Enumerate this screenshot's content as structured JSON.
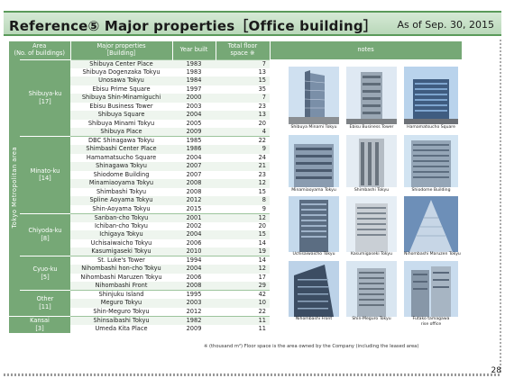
{
  "header": {
    "title": "Reference⑤ Major properties［Office building］",
    "as_of": "As of Sep. 30, 2015"
  },
  "table": {
    "headers": {
      "area": "Area",
      "area_sub": "(No. of buildings)",
      "property": "Major properties",
      "property_sub": "［Building］",
      "year": "Year built",
      "floor": "Total floor",
      "floor_sub": "space ※",
      "notes": "notes"
    },
    "metro_label": "Tokyo Metropolitan area",
    "groups": [
      {
        "area": "Shibuya-ku",
        "count": "[17]",
        "rows": [
          {
            "name": "Shibuya Center Place",
            "year": "1983",
            "floor": "7"
          },
          {
            "name": "Shibuya Dogenzaka Tokyu",
            "year": "1983",
            "floor": "13"
          },
          {
            "name": "Unosawa Tokyu",
            "year": "1984",
            "floor": "15"
          },
          {
            "name": "Ebisu Prime Square",
            "year": "1997",
            "floor": "35"
          },
          {
            "name": "Shibuya Shin-Minamiguchi",
            "year": "2000",
            "floor": "7"
          },
          {
            "name": "Ebisu Business Tower",
            "year": "2003",
            "floor": "23"
          },
          {
            "name": "Shibuya Square",
            "year": "2004",
            "floor": "13"
          },
          {
            "name": "Shibuya Minami Tokyu",
            "year": "2005",
            "floor": "20"
          },
          {
            "name": "Shibuya Place",
            "year": "2009",
            "floor": "4"
          }
        ]
      },
      {
        "area": "Minato-ku",
        "count": "[14]",
        "rows": [
          {
            "name": "DBC Shinagawa Tokyu",
            "year": "1985",
            "floor": "22"
          },
          {
            "name": "Shimbashi Center Place",
            "year": "1986",
            "floor": "9"
          },
          {
            "name": "Hamamatsucho Square",
            "year": "2004",
            "floor": "24"
          },
          {
            "name": "Shinagawa Tokyu",
            "year": "2007",
            "floor": "21"
          },
          {
            "name": "Shiodome Building",
            "year": "2007",
            "floor": "23"
          },
          {
            "name": "Minamiaoyama Tokyu",
            "year": "2008",
            "floor": "12"
          },
          {
            "name": "Shimbashi Tokyu",
            "year": "2008",
            "floor": "15"
          },
          {
            "name": "Spline Aoyama Tokyu",
            "year": "2012",
            "floor": "8"
          },
          {
            "name": "Shin-Aoyama Tokyu",
            "year": "2015",
            "floor": "9"
          }
        ]
      },
      {
        "area": "Chiyoda-ku",
        "count": "[8]",
        "rows": [
          {
            "name": "Sanban-cho Tokyu",
            "year": "2001",
            "floor": "12"
          },
          {
            "name": "Ichiban-cho Tokyu",
            "year": "2002",
            "floor": "20"
          },
          {
            "name": "Ichigaya Tokyu",
            "year": "2004",
            "floor": "15"
          },
          {
            "name": "Uchisaiwaicho Tokyu",
            "year": "2006",
            "floor": "14"
          },
          {
            "name": "Kasumigaseki Tokyu",
            "year": "2010",
            "floor": "19"
          }
        ]
      },
      {
        "area": "Cyuo-ku",
        "count": "[5]",
        "rows": [
          {
            "name": "St. Luke's Tower",
            "year": "1994",
            "floor": "14"
          },
          {
            "name": "Nihombashi hon-cho Tokyu",
            "year": "2004",
            "floor": "12"
          },
          {
            "name": "Nihombashi Maruzen Tokyu",
            "year": "2006",
            "floor": "17"
          },
          {
            "name": "Nihombashi Front",
            "year": "2008",
            "floor": "29"
          }
        ]
      },
      {
        "area": "Other",
        "count": "[11]",
        "rows": [
          {
            "name": "Shinjuku Island",
            "year": "1995",
            "floor": "42"
          },
          {
            "name": "Meguro Tokyu",
            "year": "2003",
            "floor": "10"
          },
          {
            "name": "Shin-Meguro Tokyu",
            "year": "2012",
            "floor": "22"
          }
        ]
      },
      {
        "area": "Kansai",
        "count": "[3]",
        "rows": [
          {
            "name": "Shinsaibashi Tokyu",
            "year": "1982",
            "floor": "11"
          },
          {
            "name": "Umeda Kita Place",
            "year": "2009",
            "floor": "11"
          }
        ]
      }
    ]
  },
  "photos": [
    {
      "caption": "Shibuya Minami Tokyu"
    },
    {
      "caption": "Ebisu Business Tower"
    },
    {
      "caption": "Hamamatsucho Square"
    },
    {
      "caption": "Minamiaoyama Tokyu"
    },
    {
      "caption": "Shimbashi Tokyu"
    },
    {
      "caption": "Shiodome Building"
    },
    {
      "caption": "Uchisaiwaicho Tokyu"
    },
    {
      "caption": "Kasumigaseki Tokyu"
    },
    {
      "caption": "Nihombashi Maruzen Tokyu"
    },
    {
      "caption": "Nihombashi Front"
    },
    {
      "caption": "Shin-Meguro Tokyu"
    },
    {
      "caption": "Futako tamagawa"
    },
    {
      "caption": "rise office"
    }
  ],
  "footnote": "※ (thousand m²) Floor space is the area owned by the Company (including the leased area)",
  "page_number": "28",
  "colors": {
    "accent": "#76a876",
    "row_alt": "#eef5ee",
    "title_bg": "#c6e0c6"
  }
}
